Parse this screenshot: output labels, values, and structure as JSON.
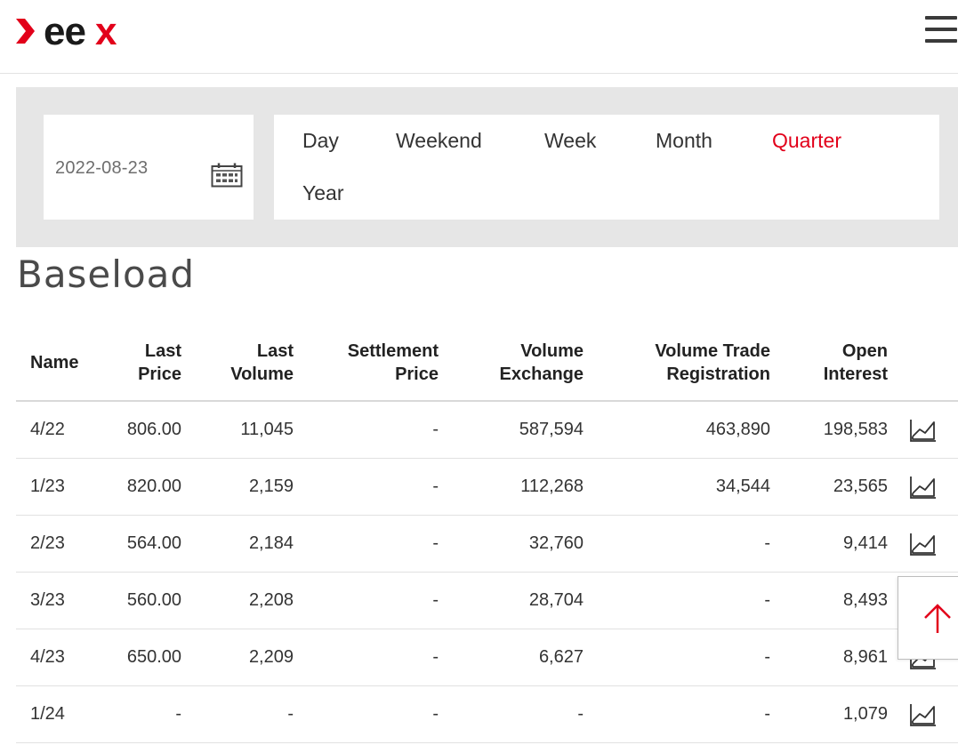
{
  "header": {
    "logo_text": "eex",
    "logo_accent_color": "#e2001a",
    "menu_icon": "hamburger-menu-icon"
  },
  "filter": {
    "date_value": "2022-08-23",
    "calendar_icon": "calendar-icon",
    "periods": [
      {
        "label": "Day",
        "active": false
      },
      {
        "label": "Weekend",
        "active": false
      },
      {
        "label": "Week",
        "active": false
      },
      {
        "label": "Month",
        "active": false
      },
      {
        "label": "Quarter",
        "active": true
      },
      {
        "label": "Year",
        "active": false
      }
    ]
  },
  "section": {
    "title": "Baseload"
  },
  "table": {
    "headers": {
      "name": "Name",
      "last_price_1": "Last",
      "last_price_2": "Price",
      "last_volume_1": "Last",
      "last_volume_2": "Volume",
      "settlement_1": "Settlement",
      "settlement_2": "Price",
      "vol_exchange_1": "Volume",
      "vol_exchange_2": "Exchange",
      "vol_trade_1": "Volume Trade",
      "vol_trade_2": "Registration",
      "open_interest_1": "Open",
      "open_interest_2": "Interest"
    },
    "rows": [
      {
        "name": "4/22",
        "last_price": "806.00",
        "last_volume": "11,045",
        "settlement_price": "-",
        "volume_exchange": "587,594",
        "volume_trade_registration": "463,890",
        "open_interest": "198,583"
      },
      {
        "name": "1/23",
        "last_price": "820.00",
        "last_volume": "2,159",
        "settlement_price": "-",
        "volume_exchange": "112,268",
        "volume_trade_registration": "34,544",
        "open_interest": "23,565"
      },
      {
        "name": "2/23",
        "last_price": "564.00",
        "last_volume": "2,184",
        "settlement_price": "-",
        "volume_exchange": "32,760",
        "volume_trade_registration": "-",
        "open_interest": "9,414"
      },
      {
        "name": "3/23",
        "last_price": "560.00",
        "last_volume": "2,208",
        "settlement_price": "-",
        "volume_exchange": "28,704",
        "volume_trade_registration": "-",
        "open_interest": "8,493"
      },
      {
        "name": "4/23",
        "last_price": "650.00",
        "last_volume": "2,209",
        "settlement_price": "-",
        "volume_exchange": "6,627",
        "volume_trade_registration": "-",
        "open_interest": "8,961"
      },
      {
        "name": "1/24",
        "last_price": "-",
        "last_volume": "-",
        "settlement_price": "-",
        "volume_exchange": "-",
        "volume_trade_registration": "-",
        "open_interest": "1,079"
      }
    ],
    "row_icon": "line-chart-icon"
  },
  "scroll_top": {
    "icon": "arrow-up-icon",
    "color": "#e2001a"
  }
}
